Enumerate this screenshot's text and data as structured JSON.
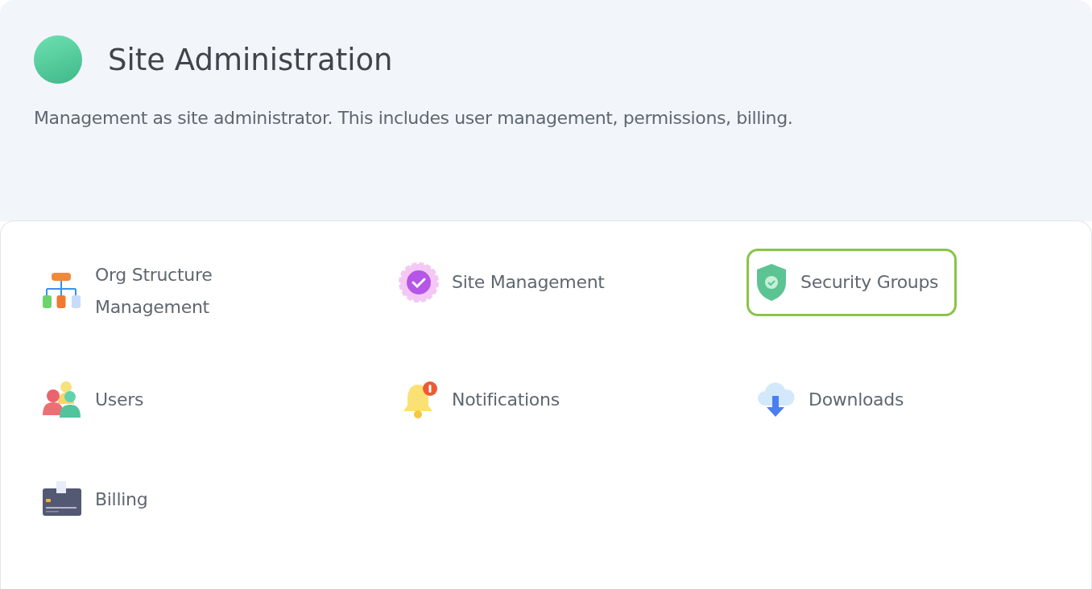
{
  "header": {
    "title": "Site Administration",
    "description": "Management as site administrator. This includes user management, permissions, billing."
  },
  "items": [
    {
      "label": "Org Structure Management",
      "kind": "org",
      "selected": false
    },
    {
      "label": "Site Management",
      "kind": "site",
      "selected": false
    },
    {
      "label": "Security Groups",
      "kind": "security",
      "selected": true
    },
    {
      "label": "Users",
      "kind": "users",
      "selected": false
    },
    {
      "label": "Notifications",
      "kind": "bell",
      "selected": false
    },
    {
      "label": "Downloads",
      "kind": "download",
      "selected": false
    },
    {
      "label": "Billing",
      "kind": "billing",
      "selected": false
    }
  ]
}
